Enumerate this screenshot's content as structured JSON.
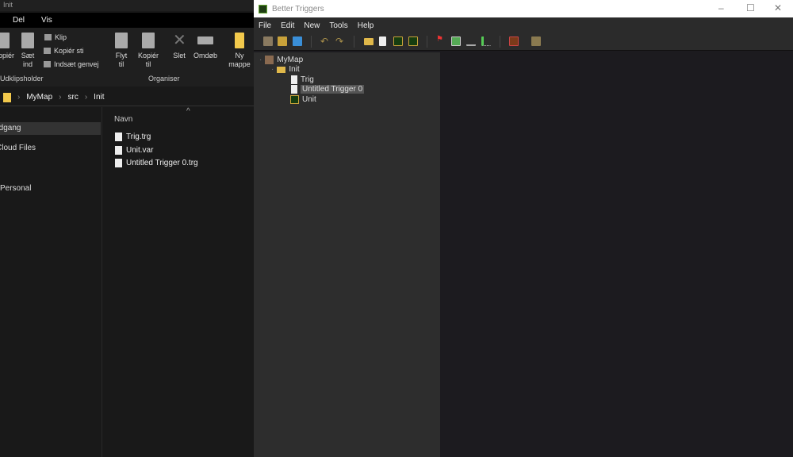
{
  "explorer": {
    "title": "Init",
    "tabs": [
      "Del",
      "Vis"
    ],
    "ribbon": {
      "copy": "Kopiér",
      "paste": [
        "Sæt",
        "ind"
      ],
      "cut": "Klip",
      "copy_path": "Kopiér sti",
      "paste_shortcut": "Indsæt genvej",
      "clipboard_group": "Udklipsholder",
      "move_to": [
        "Flyt",
        "til"
      ],
      "copy_to": [
        "Kopiér",
        "til"
      ],
      "delete": "Slet",
      "rename": "Omdøb",
      "new_folder": [
        "Ny",
        "mappe"
      ],
      "organise_group": "Organiser"
    },
    "breadcrumb": [
      "MyMap",
      "src",
      "Init"
    ],
    "nav": [
      "Adgang",
      "Cloud Files",
      "Personal"
    ],
    "column_header": "Navn",
    "files": [
      "Trig.trg",
      "Unit.var",
      "Untitled Trigger 0.trg"
    ]
  },
  "app": {
    "title": "Better Triggers",
    "menu": [
      "File",
      "Edit",
      "New",
      "Tools",
      "Help"
    ],
    "tree": {
      "root": "MyMap",
      "folder": "Init",
      "items": [
        "Trig",
        "Untitled Trigger 0",
        "Unit"
      ],
      "selected": "Untitled Trigger 0"
    }
  }
}
